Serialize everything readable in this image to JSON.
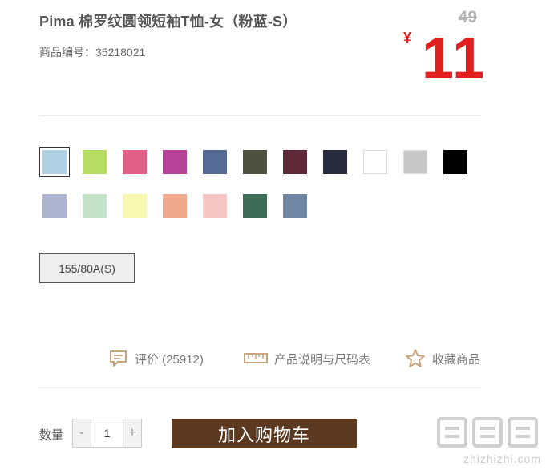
{
  "product": {
    "title": "Pima 棉罗纹圆领短袖T恤-女（粉蓝-S）",
    "sku_label": "商品编号：35218021",
    "original_price": "49",
    "currency": "¥",
    "price": "11"
  },
  "colors": [
    {
      "name": "powder-blue",
      "hex": "#b0d0e3",
      "selected": true
    },
    {
      "name": "lime-green",
      "hex": "#b6dc64"
    },
    {
      "name": "pink",
      "hex": "#e06088"
    },
    {
      "name": "magenta",
      "hex": "#b8449a"
    },
    {
      "name": "slate-blue",
      "hex": "#566a96"
    },
    {
      "name": "olive-dark",
      "hex": "#4f5140"
    },
    {
      "name": "burgundy",
      "hex": "#5e2838"
    },
    {
      "name": "navy",
      "hex": "#262a3c"
    },
    {
      "name": "white",
      "hex": "#ffffff"
    },
    {
      "name": "heather-gray",
      "hex": "#c8c8c8"
    },
    {
      "name": "black",
      "hex": "#000000"
    },
    {
      "name": "lavender-gray",
      "hex": "#aeb4d0"
    },
    {
      "name": "mint",
      "hex": "#c4e3c8"
    },
    {
      "name": "pale-yellow",
      "hex": "#f7f8b2"
    },
    {
      "name": "salmon",
      "hex": "#f1a98e"
    },
    {
      "name": "light-pink",
      "hex": "#f5c6c4"
    },
    {
      "name": "forest-green",
      "hex": "#3e6a58"
    },
    {
      "name": "steel-blue",
      "hex": "#6f87a5"
    }
  ],
  "sizes": [
    {
      "label": "155/80A(S)",
      "selected": true
    }
  ],
  "actions": {
    "reviews": "评价 (25912)",
    "size_guide": "产品说明与尺码表",
    "favorite": "收藏商品"
  },
  "purchase": {
    "qty_label": "数量",
    "qty_value": "1",
    "minus": "-",
    "plus": "+",
    "add_to_cart": "加入购物车"
  },
  "watermark": {
    "text": "zhizhizhi.com"
  }
}
